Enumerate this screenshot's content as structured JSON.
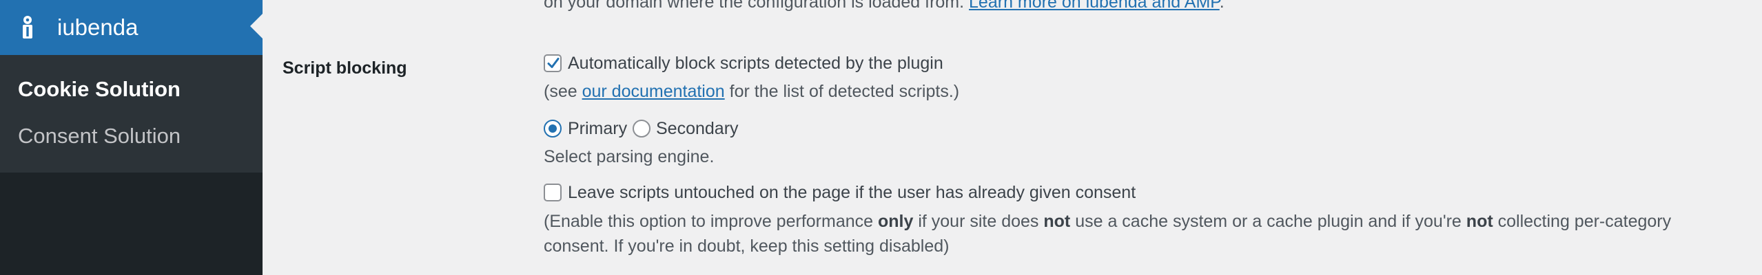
{
  "sidebar": {
    "menu_title": "iubenda",
    "menu_icon": "iubenda-logo-icon",
    "items": [
      {
        "label": "Cookie Solution",
        "current": true
      },
      {
        "label": "Consent Solution",
        "current": false
      }
    ]
  },
  "main": {
    "top_text": "on your domain where the configuration is loaded from.",
    "top_link": "Learn more on iubenda and AMP",
    "top_end": ".",
    "script_blocking": {
      "label": "Script blocking",
      "auto_block": {
        "checked": true,
        "label": "Automatically block scripts detected by the plugin"
      },
      "doc_prefix": "(see ",
      "doc_link": "our documentation",
      "doc_suffix": " for the list of detected scripts.)",
      "engine": {
        "options": [
          "Primary",
          "Secondary"
        ],
        "selected": "Primary",
        "description": "Select parsing engine."
      },
      "leave_untouched": {
        "checked": false,
        "label": "Leave scripts untouched on the page if the user has already given consent"
      },
      "perf_note": {
        "t1": "(Enable this option to improve performance ",
        "b1": "only",
        "t2": " if your site does ",
        "b2": "not",
        "t3": " use a cache system or a cache plugin and if you're ",
        "b3": "not",
        "t4": " collecting per-category",
        "line2": "consent. If you're in doubt, keep this setting disabled)"
      }
    }
  },
  "colors": {
    "sidebar_bg": "#1d2327",
    "submenu_bg": "#2c3338",
    "accent": "#2271b1",
    "content_bg": "#f0f0f1"
  }
}
